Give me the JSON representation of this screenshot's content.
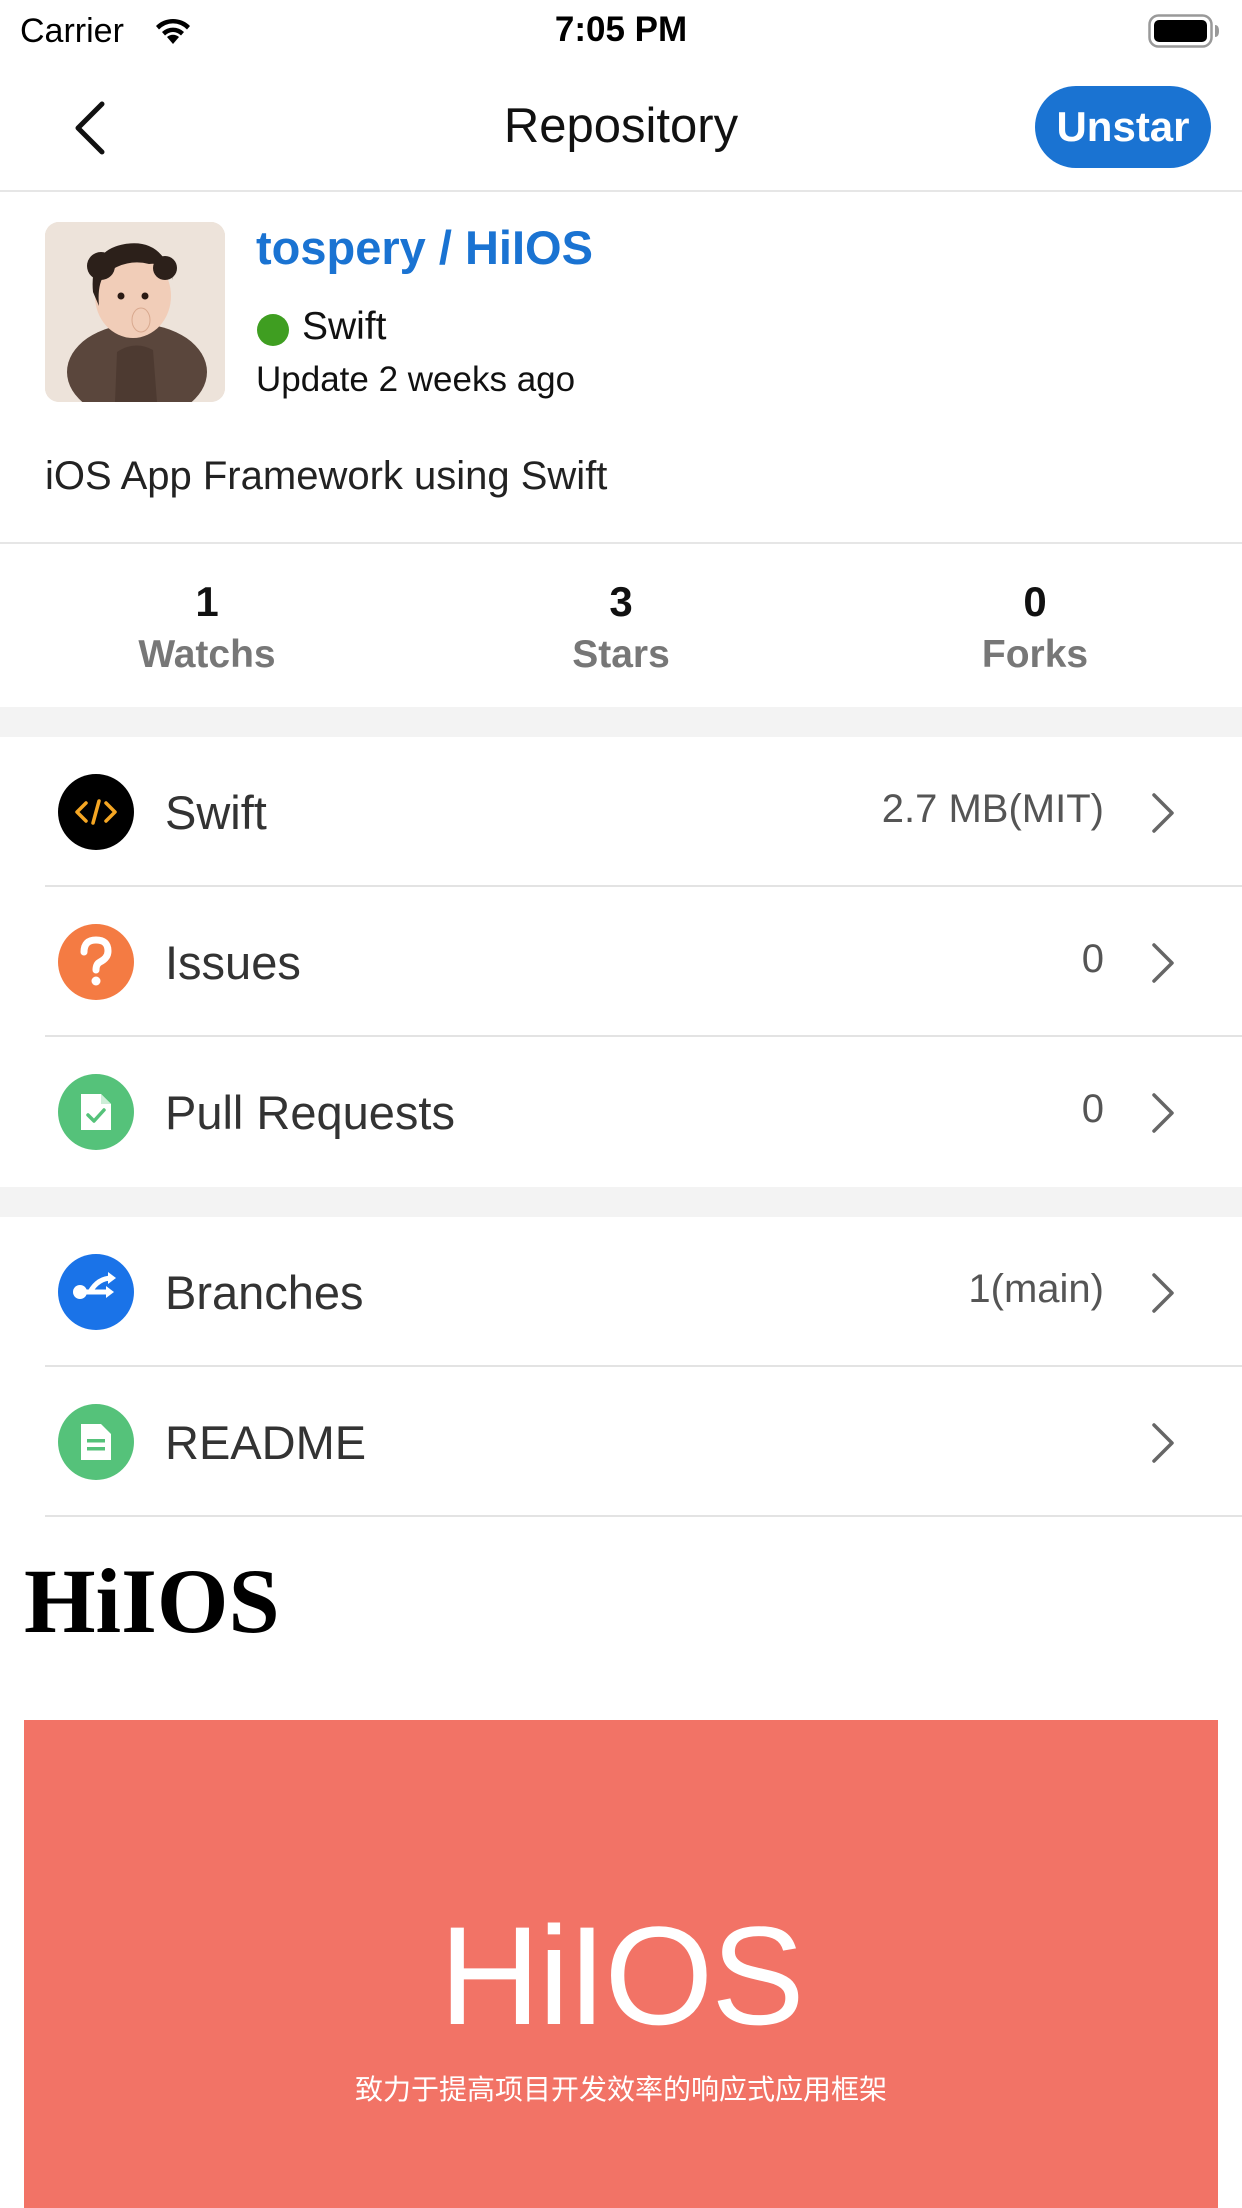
{
  "status_bar": {
    "carrier": "Carrier",
    "time": "7:05 PM"
  },
  "nav": {
    "title": "Repository",
    "unstar_label": "Unstar"
  },
  "repo": {
    "name": "tospery / HiIOS",
    "language": "Swift",
    "updated": "Update 2 weeks ago",
    "description": "iOS App Framework using Swift",
    "language_color": "#3f9e21"
  },
  "stats": [
    {
      "count": "1",
      "label": "Watchs"
    },
    {
      "count": "3",
      "label": "Stars"
    },
    {
      "count": "0",
      "label": "Forks"
    }
  ],
  "list_group_1": [
    {
      "icon": "code-icon",
      "label": "Swift",
      "value": "2.7 MB(MIT)",
      "color": "#000000"
    },
    {
      "icon": "question-icon",
      "label": "Issues",
      "value": "0",
      "color": "#f47b43"
    },
    {
      "icon": "pull-request-icon",
      "label": "Pull Requests",
      "value": "0",
      "color": "#55c27a"
    }
  ],
  "list_group_2": [
    {
      "icon": "branch-icon",
      "label": "Branches",
      "value": "1(main)",
      "color": "#1a73e8"
    },
    {
      "icon": "document-icon",
      "label": "README",
      "value": "",
      "color": "#55c27a"
    }
  ],
  "readme": {
    "heading": "HiIOS",
    "banner_title": "HiIOS",
    "banner_subtitle": "致力于提高项目开发效率的响应式应用框架",
    "banner_color": "#f27366"
  },
  "colors": {
    "accent": "#1a73d2"
  }
}
